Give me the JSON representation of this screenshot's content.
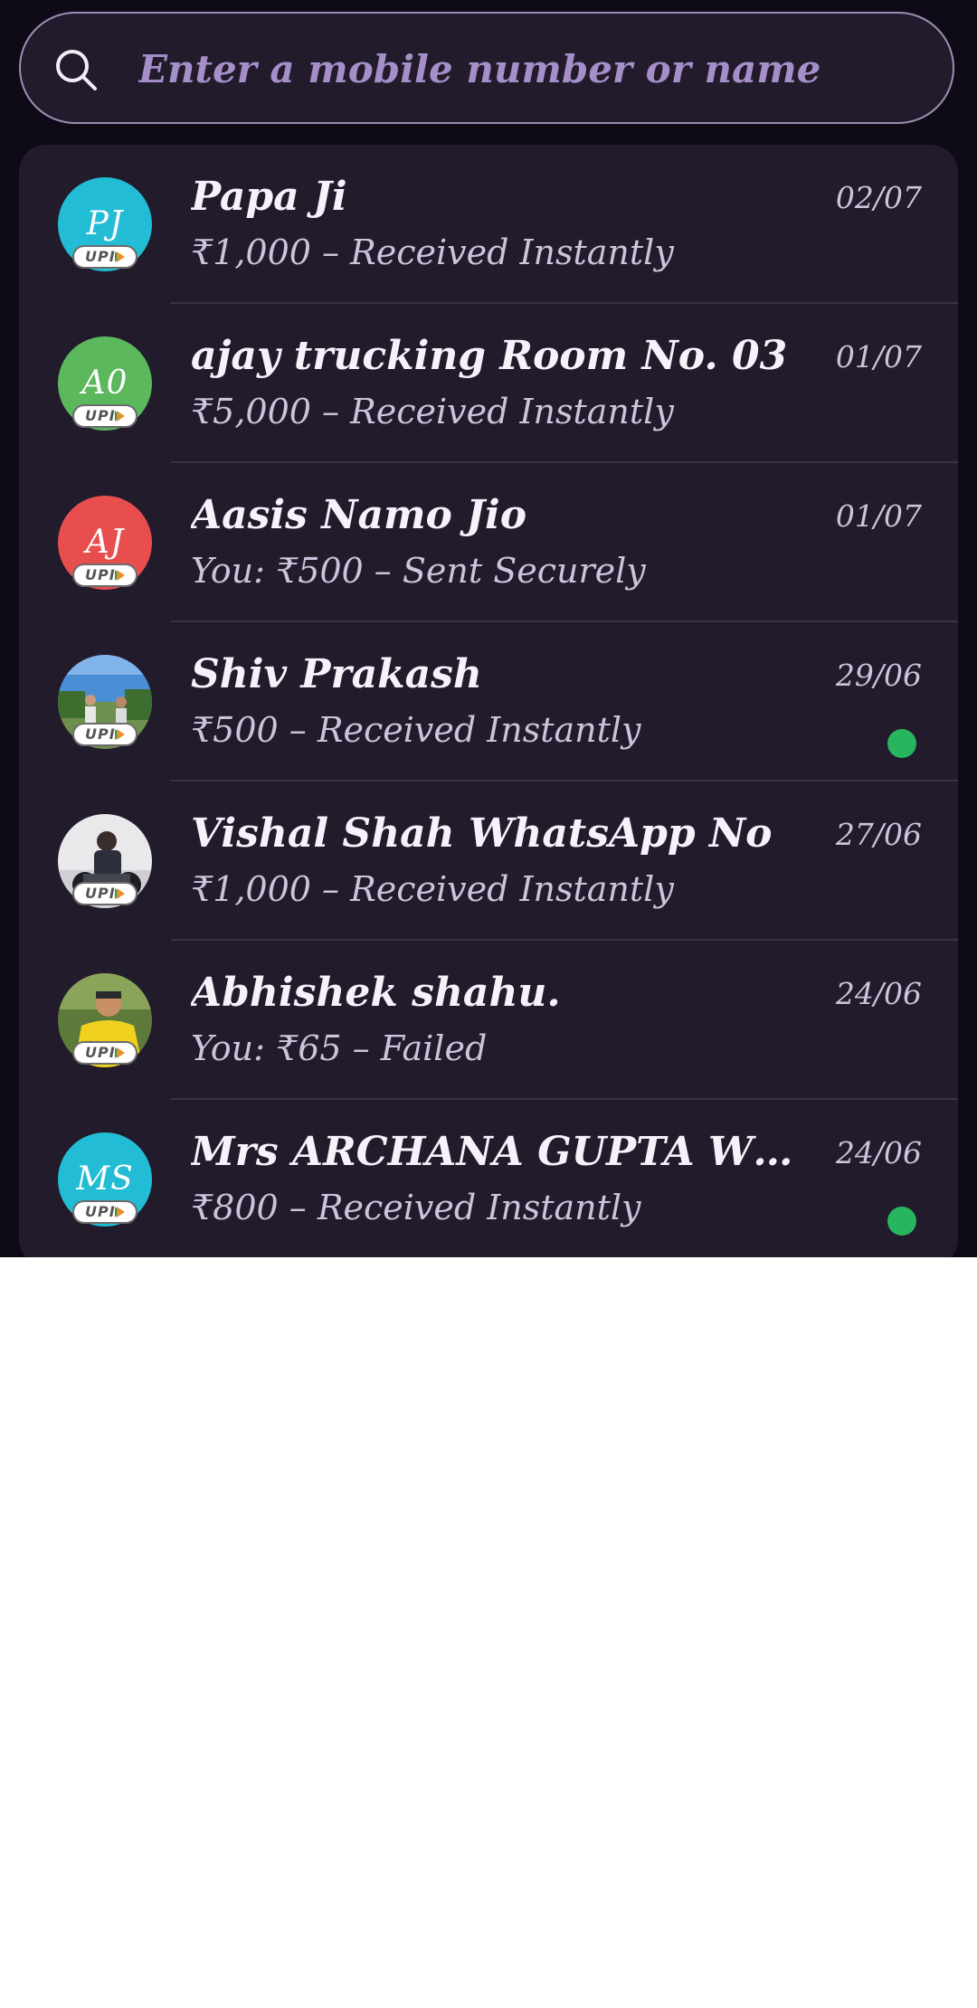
{
  "search": {
    "placeholder": "Enter a mobile number or name",
    "icon": "search-icon"
  },
  "badge_label": "UPI",
  "transactions": [
    {
      "name": "Papa Ji",
      "subtitle": "₹1,000 – Received Instantly",
      "date": "02/07",
      "avatar_initials": "PJ",
      "avatar_color": "#22bcd4",
      "unread": false
    },
    {
      "name": "ajay trucking Room No. 03",
      "subtitle": "₹5,000 – Received Instantly",
      "date": "01/07",
      "avatar_initials": "A0",
      "avatar_color": "#5cb85c",
      "unread": false
    },
    {
      "name": "Aasis Namo Jio",
      "subtitle": "You: ₹500 – Sent Securely",
      "date": "01/07",
      "avatar_initials": "AJ",
      "avatar_color": "#e94e4e",
      "unread": false
    },
    {
      "name": "Shiv Prakash",
      "subtitle": "₹500 – Received Instantly",
      "date": "29/06",
      "avatar_initials": "",
      "avatar_photo": "outdoor-people-photo",
      "unread": true
    },
    {
      "name": "Vishal Shah WhatsApp No",
      "subtitle": "₹1,000 – Received Instantly",
      "date": "27/06",
      "avatar_initials": "",
      "avatar_photo": "motorbike-rider-photo",
      "unread": false
    },
    {
      "name": "Abhishek shahu.",
      "subtitle": "You: ₹65 – Failed",
      "date": "24/06",
      "avatar_initials": "",
      "avatar_photo": "yellow-shirt-person-photo",
      "unread": false
    },
    {
      "name": "Mrs ARCHANA GUPTA WO ABHI...",
      "subtitle": "₹800 – Received Instantly",
      "date": "24/06",
      "avatar_initials": "MS",
      "avatar_color": "#22bcd4",
      "unread": true
    }
  ],
  "colors": {
    "background": "#0e0a16",
    "card": "#221b2c",
    "unread_dot": "#27b55e",
    "placeholder": "#a58fc9"
  }
}
